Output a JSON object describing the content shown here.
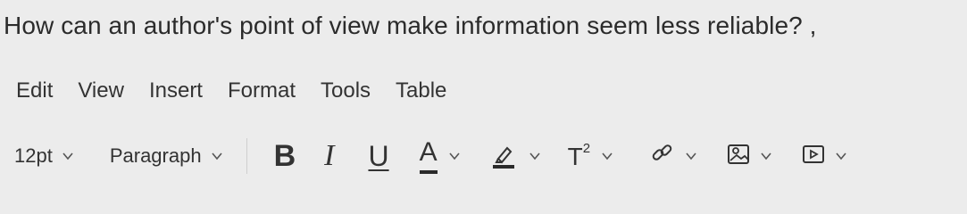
{
  "question": {
    "text": "How can an author's point of view make information seem less reliable? ,"
  },
  "menu": {
    "items": [
      {
        "label": "Edit"
      },
      {
        "label": "View"
      },
      {
        "label": "Insert"
      },
      {
        "label": "Format"
      },
      {
        "label": "Tools"
      },
      {
        "label": "Table"
      }
    ]
  },
  "toolbar": {
    "font_size": "12pt",
    "block_format": "Paragraph",
    "bold_glyph": "B",
    "italic_glyph": "I",
    "underline_glyph": "U",
    "font_color_glyph": "A",
    "superscript_base": "T",
    "superscript_exp": "2",
    "icons": [
      "chevron-down-icon",
      "highlighter-icon",
      "link-icon",
      "image-icon",
      "media-icon"
    ],
    "colors": {
      "background": "#ececec",
      "text": "#333333",
      "separator": "#cfcfcf"
    }
  }
}
